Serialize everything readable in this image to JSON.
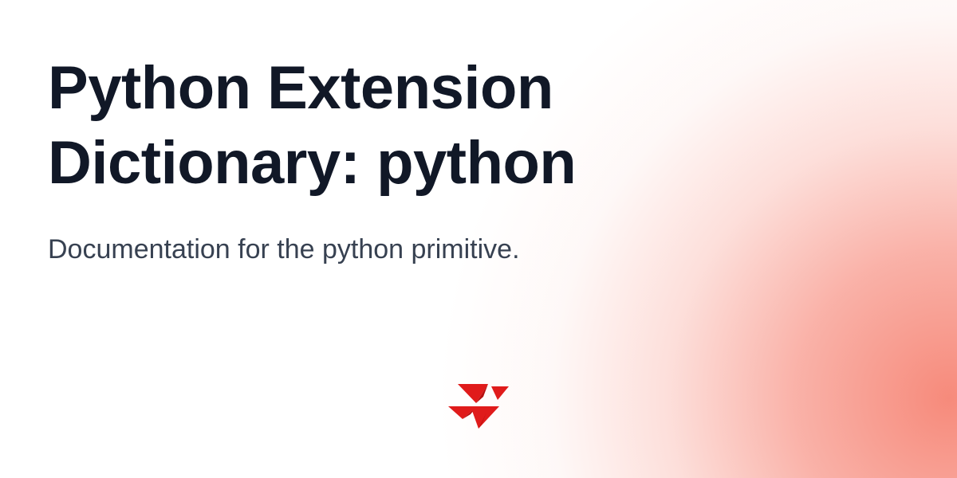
{
  "title": {
    "line1": "Python Extension",
    "line2": "Dictionary: python"
  },
  "subtitle": "Documentation for the python primitive.",
  "logo": {
    "icon": "red-triangles-logo-icon",
    "color": "#e01b1b",
    "color_dark": "#b80f0f"
  },
  "colors": {
    "title": "#111827",
    "subtitle": "#374151",
    "glow": "#f68474",
    "background": "#ffffff"
  }
}
